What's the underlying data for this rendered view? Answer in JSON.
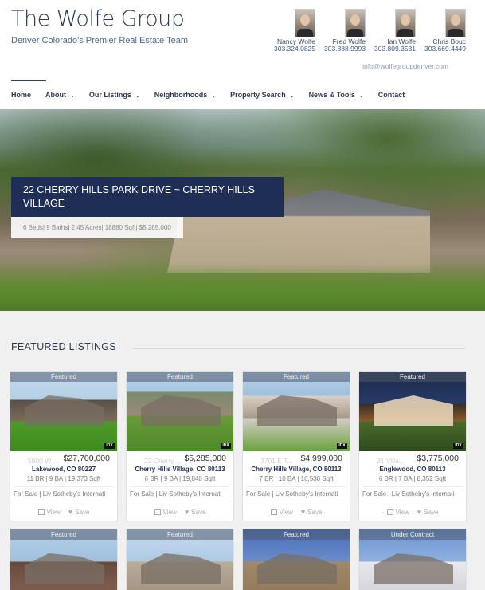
{
  "header": {
    "title": "The Wolfe Group",
    "tagline": "Denver Colorado's Premier Real Estate Team"
  },
  "agents": [
    {
      "name": "Nancy Wolfe",
      "phone": "303.324.0825"
    },
    {
      "name": "Fred Wolfe",
      "phone": "303.888.9993"
    },
    {
      "name": "Ian Wolfe",
      "phone": "303.809.3531"
    },
    {
      "name": "Chris Bouc",
      "phone": "303.669.4449"
    }
  ],
  "email": "info@wolfegroupdenver.com",
  "nav": [
    {
      "label": "Home",
      "dropdown": false
    },
    {
      "label": "About",
      "dropdown": true
    },
    {
      "label": "Our Listings",
      "dropdown": true
    },
    {
      "label": "Neighborhoods",
      "dropdown": true
    },
    {
      "label": "Property Search",
      "dropdown": true
    },
    {
      "label": "News & Tools",
      "dropdown": true
    },
    {
      "label": "Contact",
      "dropdown": false
    }
  ],
  "hero": {
    "title": "22 CHERRY HILLS PARK DRIVE ~ CHERRY HILLS VILLAGE",
    "meta": "6 Beds|  9 Baths|  2.45 Acres|  18880 Sqft|  $5,285,000"
  },
  "featured": {
    "heading": "FEATURED LISTINGS",
    "view_label": "View",
    "save_label": "Save",
    "idx_label": "IDX",
    "cards": [
      {
        "badge": "Featured",
        "addr": "5900 W ...",
        "price": "$27,700,000",
        "city": "Lakewood, CO 80227",
        "specs": "11 BR | 9 BA | 19,373 Sqft",
        "broker": "For Sale | Liv Sotheby's Internati"
      },
      {
        "badge": "Featured",
        "addr": "22 Cherry ...",
        "price": "$5,285,000",
        "city": "Cherry Hills Village, CO 80113",
        "specs": "6 BR | 9 BA | 19,840 Sqft",
        "broker": "For Sale | Liv Sotheby's Internati"
      },
      {
        "badge": "Featured",
        "addr": "3701 E T...",
        "price": "$4,999,000",
        "city": "Cherry Hills Village, CO 80113",
        "specs": "7 BR | 10 BA | 10,530 Sqft",
        "broker": "For Sale | Liv Sotheby's Internati"
      },
      {
        "badge": "Featured",
        "addr": "31 Villa...",
        "price": "$3,775,000",
        "city": "Englewood, CO 80113",
        "specs": "6 BR | 7 BA | 8,352 Sqft",
        "broker": "For Sale | Liv Sotheby's Internati"
      },
      {
        "badge": "Featured"
      },
      {
        "badge": "Featured"
      },
      {
        "badge": "Featured"
      },
      {
        "badge": "Under Contract"
      }
    ]
  }
}
